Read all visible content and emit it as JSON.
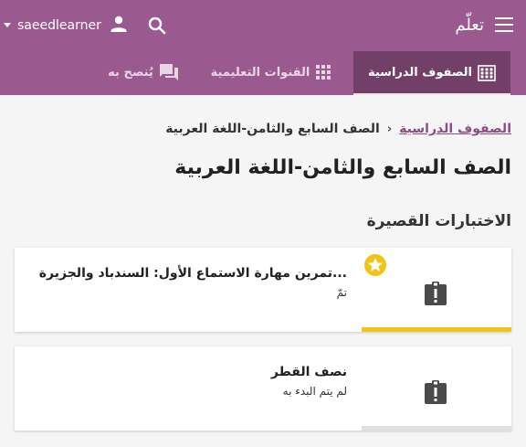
{
  "app": {
    "title": "تعلّم",
    "username": "saeedlearner"
  },
  "tabs": [
    {
      "label": "الصفوف الدراسية",
      "icon": "classes-grid-icon",
      "active": true
    },
    {
      "label": "القنوات التعليمية",
      "icon": "channels-grid-icon",
      "active": false
    },
    {
      "label": "يُنصح به",
      "icon": "recommended-chat-icon",
      "active": false
    }
  ],
  "breadcrumb": {
    "root": "الصفوف الدراسية",
    "separator": "›",
    "current": "الصف السابع والثامن-اللغة العربية"
  },
  "page": {
    "title": "الصف السابع والثامن-اللغة العربية",
    "section_title": "الاختبارات القصيرة"
  },
  "cards": [
    {
      "title": "تمرين مهارة الاستماع الأول: السندباد والجزيرة...",
      "status": "تمّ",
      "progress": 1.0,
      "progress_color": "#f0c419",
      "completed_star": true,
      "icon": "quiz-clipboard-icon"
    },
    {
      "title": "نصف القطر",
      "status": "لم يتم البدء به",
      "progress": 0.0,
      "progress_color": "#e0e0e0",
      "completed_star": false,
      "icon": "quiz-clipboard-icon"
    }
  ],
  "colors": {
    "appbar": "#9a5a8f",
    "active_tab": "#723f69",
    "link": "#8a4e81",
    "star": "#f0c419"
  }
}
